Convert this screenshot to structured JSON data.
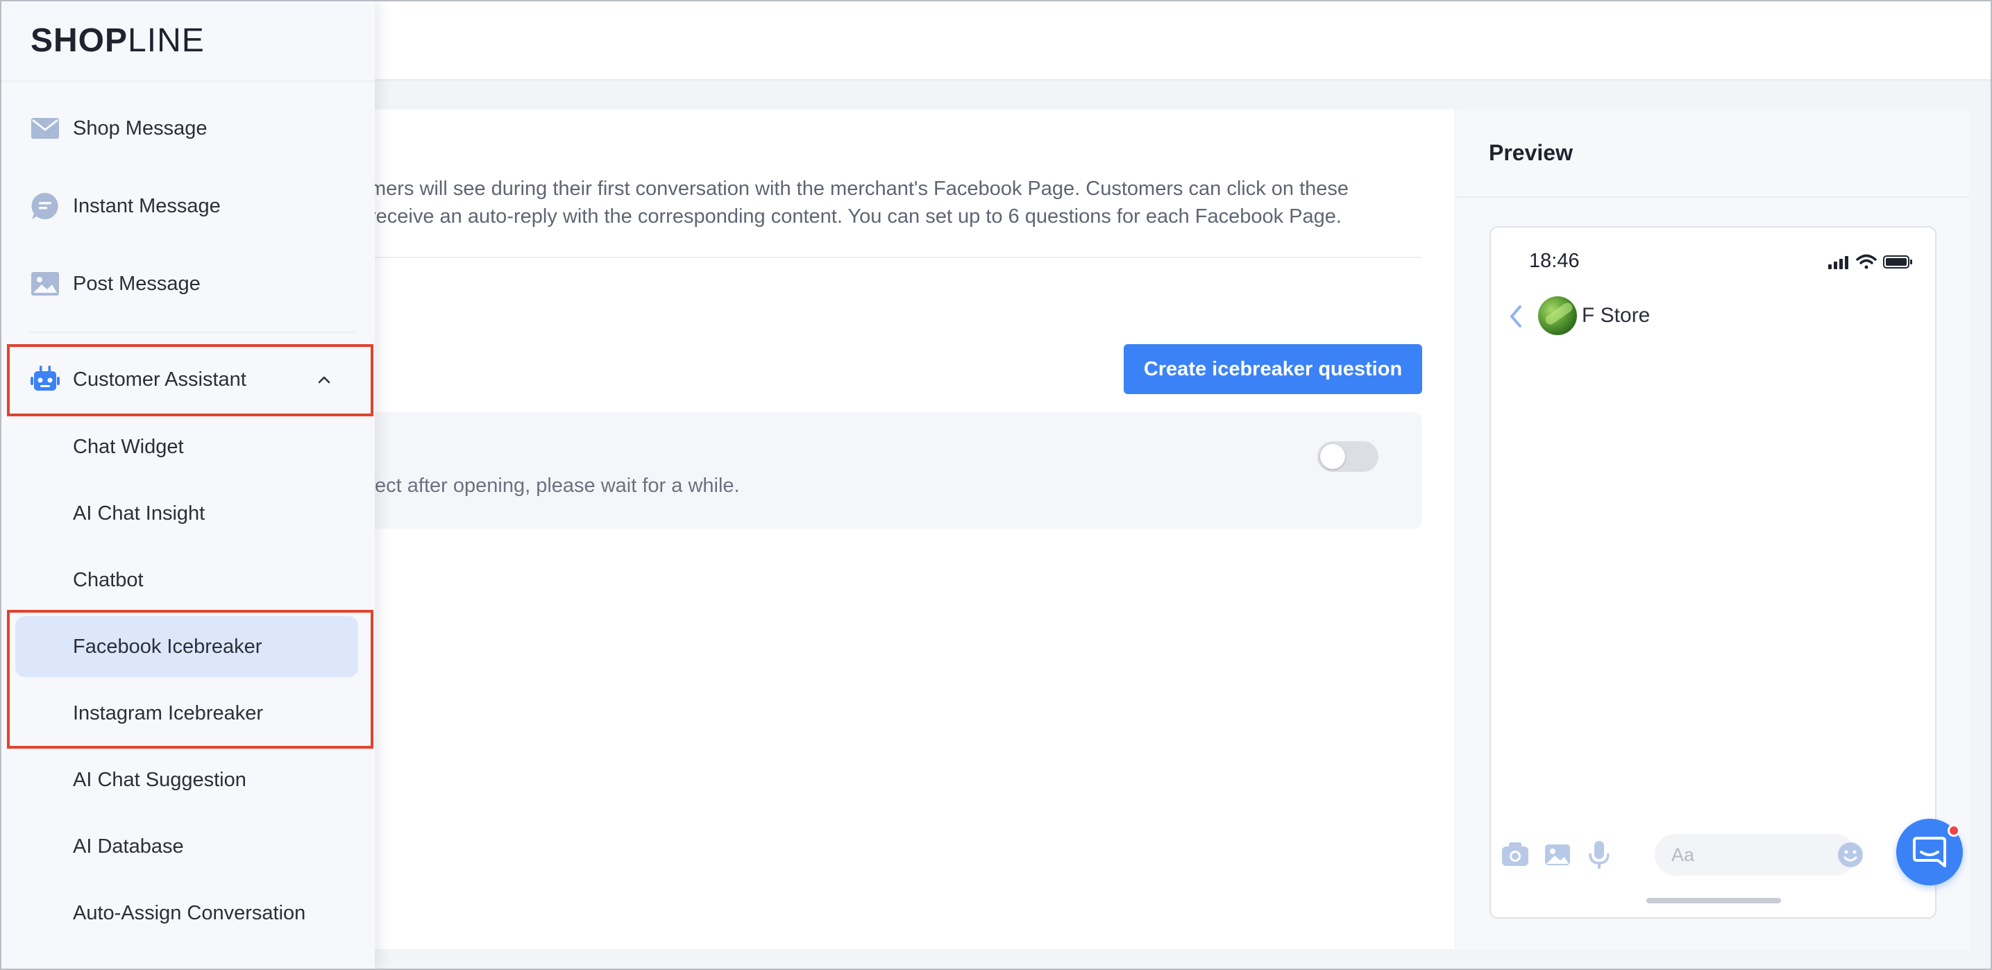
{
  "brand": {
    "logo_bold": "SHOP",
    "logo_light": "LINE"
  },
  "sidebar": {
    "items": [
      {
        "label": "Shop Message",
        "icon": "envelope-icon"
      },
      {
        "label": "Instant Message",
        "icon": "chat-bubble-icon"
      },
      {
        "label": "Post Message",
        "icon": "image-icon"
      },
      {
        "label": "Customer Assistant",
        "icon": "robot-icon",
        "expanded": true
      }
    ],
    "sub_items": [
      {
        "label": "Chat Widget"
      },
      {
        "label": "AI Chat Insight"
      },
      {
        "label": "Chatbot"
      },
      {
        "label": "Facebook Icebreaker",
        "active": true
      },
      {
        "label": "Instagram Icebreaker"
      },
      {
        "label": "AI Chat Suggestion"
      },
      {
        "label": "AI Database"
      },
      {
        "label": "Auto-Assign Conversation"
      }
    ]
  },
  "main": {
    "description_line1": "mers will see during their first conversation with the merchant's Facebook Page. Customers can click on these",
    "description_line2": "receive an auto-reply with the corresponding content. You can set up to 6 questions for each Facebook Page.",
    "create_button_label": "Create icebreaker question",
    "toggle_hint": "fect after opening, please wait for a while.",
    "toggle_on": false
  },
  "preview": {
    "title": "Preview",
    "phone_time": "18:46",
    "store_name": "F Store",
    "input_placeholder": "Aa"
  },
  "colors": {
    "accent": "#3b82f6",
    "highlight_border": "#e0432f",
    "active_item_bg": "#dde7fb",
    "notification_dot": "#ef4444"
  }
}
